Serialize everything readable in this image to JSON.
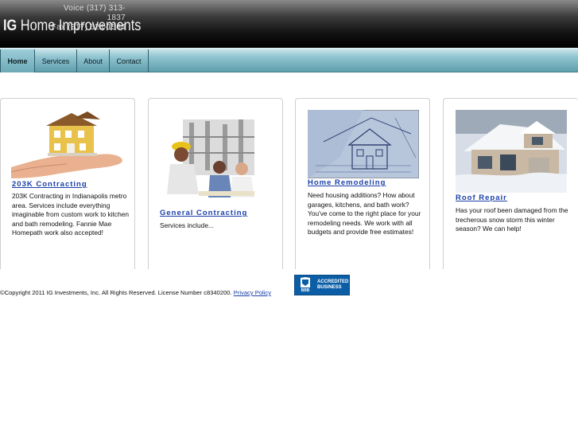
{
  "header": {
    "contact": {
      "voice": "Voice  (317) 313-1837",
      "fax": "Fax  (317) 524-1564"
    },
    "logo": {
      "ig": "IG",
      "name": "Home Improvements"
    }
  },
  "nav": {
    "items": [
      {
        "label": "Home",
        "active": true
      },
      {
        "label": "Services",
        "active": false
      },
      {
        "label": "About",
        "active": false
      },
      {
        "label": "Contact",
        "active": false
      }
    ]
  },
  "cards": [
    {
      "title": "203K Contracting",
      "body": "203K Contracting in Indianapolis metro area. Services include everything imaginable from custom work to kitchen and bath remodeling. Fannie Mae Homepath work also accepted!",
      "image": "house-in-hand-image"
    },
    {
      "title": "General Contracting",
      "body": "Services include...",
      "image": "construction-workers-image"
    },
    {
      "title": "Home Remodeling",
      "body": "Need housing additions? How about garages, kitchens, and bath work? You've come to the right place for your remodeling needs. We work with all budgets and provide free estimates!",
      "image": "blueprint-image"
    },
    {
      "title": "Roof Repair",
      "body": "Has your roof been damaged from the trecherous snow storm this winter season? We can help!",
      "image": "snowy-roof-house-image"
    }
  ],
  "footer": {
    "copyright": "©Copyright 2011 IG Investments, Inc. All Rights Reserved. License Number c8340200. ",
    "privacy": "Privacy Policy",
    "bbb": {
      "seal": "BBB",
      "line1": "ACCREDITED",
      "line2": "BUSINESS"
    }
  },
  "colors": {
    "link": "#1a40a8",
    "nav": "#8fc3cf",
    "header": "#000000",
    "bbb": "#0b5ea6"
  }
}
